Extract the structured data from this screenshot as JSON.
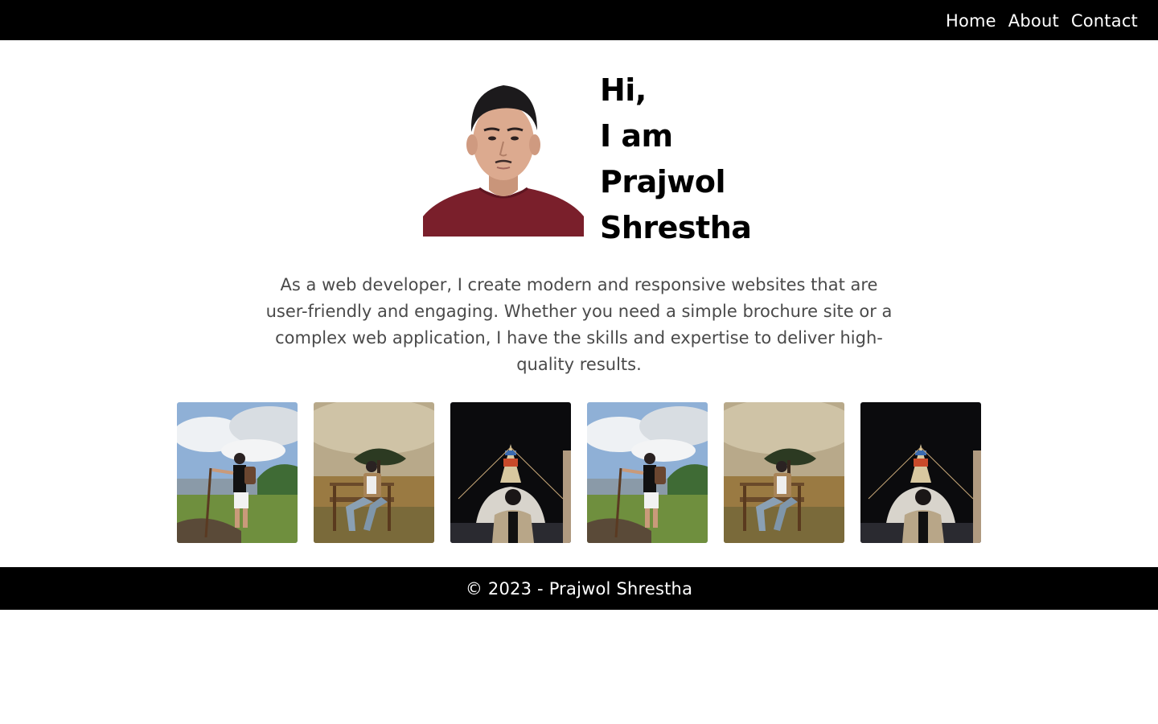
{
  "nav": {
    "links": [
      "Home",
      "About",
      "Contact"
    ]
  },
  "hero": {
    "lines": [
      "Hi,",
      "I am",
      "Prajwol",
      "Shrestha"
    ]
  },
  "intro": {
    "text": "As a web developer, I create modern and responsive websites that are user-friendly and engaging. Whether you need a simple brochure site or a complex web application, I have the skills and expertise to deliver high-quality results."
  },
  "gallery": {
    "photos": [
      "hiking-photo",
      "bench-photo",
      "stupa-night-photo",
      "hiking-photo",
      "bench-photo",
      "stupa-night-photo"
    ]
  },
  "footer": {
    "text": "© 2023 - Prajwol Shrestha"
  },
  "colors": {
    "nav_bg": "#000000",
    "footer_bg": "#000000",
    "body_text": "#4a4a4a"
  }
}
